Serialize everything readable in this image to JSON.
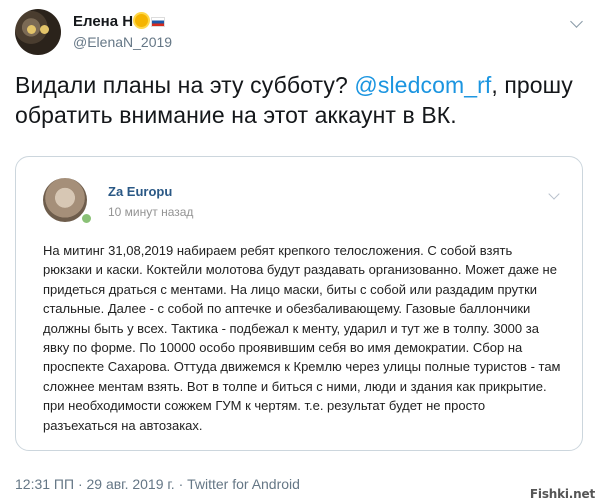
{
  "tweet": {
    "author_name": "Елена Н",
    "author_handle": "@ElenaN_2019",
    "text_before": "Видали планы на эту субботу? ",
    "mention": "@sledcom_rf",
    "text_after": ", прошу обратить внимание на этот аккаунт в ВК.",
    "footer": "12:31 ПП · 29 авг. 2019 г. · Twitter for Android"
  },
  "quoted_post": {
    "author": "Za Europu",
    "time": "10 минут назад",
    "text": "На митинг 31,08,2019 набираем ребят крепкого телосложения. С собой взять рюкзаки и каски. Коктейли молотова будут раздавать организованно. Может даже не придеться драться с ментами. На лицо маски, биты с собой или раздадим прутки стальные. Далее - с собой по аптечке и обезбаливающему. Газовые баллончики должны быть у всех. Тактика - подбежал к менту, ударил и тут же в толпу. 3000 за явку по форме. По 10000 особо проявившим себя во имя демократии. Сбор на проспекте Сахарова. Оттуда движемся к Кремлю через улицы полные туристов - там сложнее ментам взять. Вот в толпе и биться с ними, люди и здания как прикрытие. при необходимости сожжем ГУМ к чертям. т.е. результат будет не просто разъехаться на автозаках."
  },
  "watermark": "Fishki.net",
  "icons": {
    "avatar": "owl-avatar",
    "badge1": "sun-icon",
    "badge2": "russia-flag-icon",
    "caret": "chevron-down-icon"
  },
  "colors": {
    "mention": "#1b95e0",
    "vk_name": "#2a5885",
    "secondary_text": "#657786",
    "card_border": "#ccd6dd"
  }
}
